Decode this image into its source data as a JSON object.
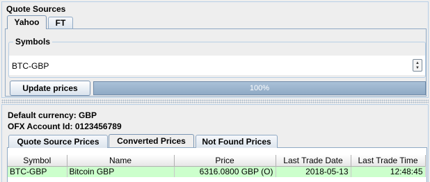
{
  "quote_sources": {
    "title": "Quote Sources",
    "tabs": [
      {
        "label": "Yahoo",
        "active": true
      },
      {
        "label": "FT",
        "active": false
      }
    ],
    "symbols_label": "Symbols",
    "symbols_value": "BTC-GBP",
    "update_button": "Update prices",
    "progress_text": "100%",
    "progress_percent": 100
  },
  "info": {
    "default_currency": "Default currency: GBP",
    "ofx_account": "OFX Account Id: 0123456789"
  },
  "result_tabs": [
    {
      "label": "Quote Source Prices",
      "active": false
    },
    {
      "label": "Converted Prices",
      "active": true
    },
    {
      "label": "Not Found Prices",
      "active": false
    }
  ],
  "table": {
    "columns": [
      "Symbol",
      "Name",
      "Price",
      "Last Trade Date",
      "Last Trade Time"
    ],
    "rows": [
      [
        "BTC-GBP",
        "Bitcoin GBP",
        "6316.0800 GBP (O)",
        "2018-05-13",
        "12:48:45"
      ]
    ],
    "row_highlight_color": "#ccffcc"
  },
  "icons": {
    "spinner": "up-down-spinner-icon"
  }
}
